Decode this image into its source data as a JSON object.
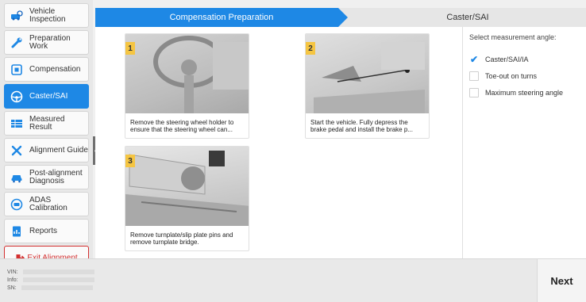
{
  "sidebar": {
    "items": [
      {
        "label": "Vehicle Inspection",
        "icon": "car-search-icon"
      },
      {
        "label": "Preparation Work",
        "icon": "wrench-icon"
      },
      {
        "label": "Compensation",
        "icon": "target-icon"
      },
      {
        "label": "Caster/SAI",
        "icon": "steering-wheel-icon"
      },
      {
        "label": "Measured Result",
        "icon": "table-icon"
      },
      {
        "label": "Alignment Guide",
        "icon": "tools-icon"
      },
      {
        "label": "Post-alignment Diagnosis",
        "icon": "car-icon"
      },
      {
        "label": "ADAS Calibration",
        "icon": "adas-icon"
      },
      {
        "label": "Reports",
        "icon": "report-icon"
      }
    ],
    "active_index": 3,
    "exit_label": "Exit Alignment"
  },
  "tabs": {
    "active": "Compensation Preparation",
    "inactive": "Caster/SAI"
  },
  "steps": [
    {
      "number": "1",
      "text": "Remove the steering wheel holder to ensure that the steering wheel can..."
    },
    {
      "number": "2",
      "text": "Start the vehicle. Fully depress the brake pedal and install the brake p..."
    },
    {
      "number": "3",
      "text": "Remove turnplate/slip plate pins and remove turnplate bridge."
    }
  ],
  "options": {
    "title": "Select measurement angle:",
    "items": [
      {
        "label": "Caster/SAI/IA",
        "checked": true
      },
      {
        "label": "Toe-out on turns",
        "checked": false
      },
      {
        "label": "Maximum steering angle",
        "checked": false
      }
    ]
  },
  "footer": {
    "vin_label": "VIN:",
    "info_label": "Info:",
    "sn_label": "SN:",
    "next_label": "Next"
  },
  "colors": {
    "accent": "#1e88e5",
    "exit": "#d32f2f",
    "step_badge": "#f5c542"
  }
}
